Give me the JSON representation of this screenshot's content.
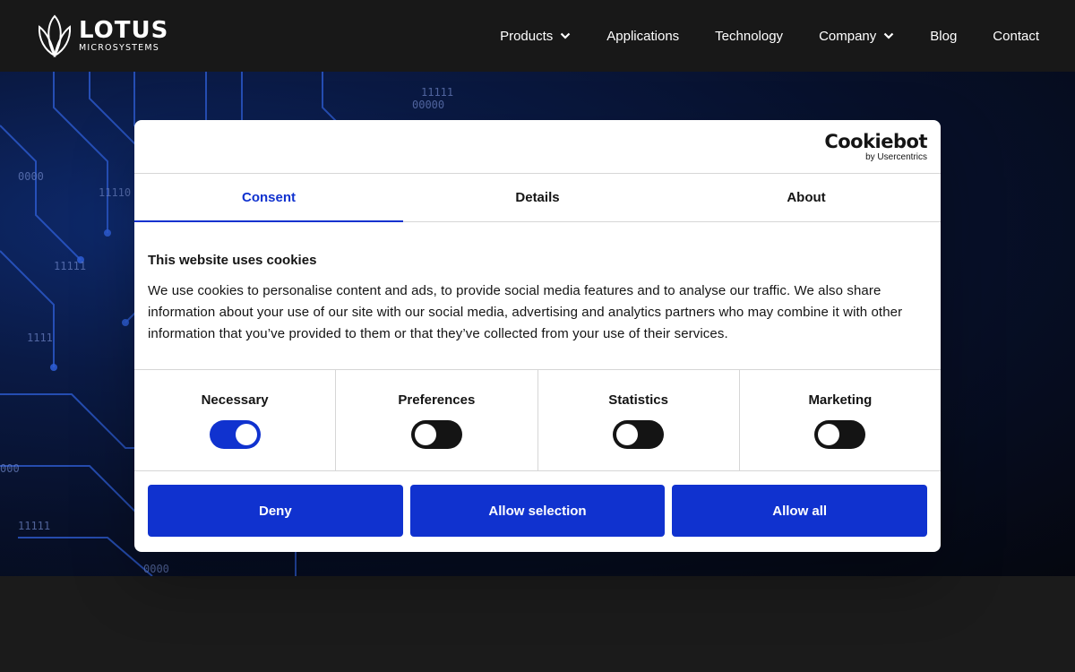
{
  "header": {
    "logo_word": "LOTUS",
    "logo_sub": "MICROSYSTEMS",
    "nav": [
      {
        "label": "Products",
        "has_dropdown": true
      },
      {
        "label": "Applications",
        "has_dropdown": false
      },
      {
        "label": "Technology",
        "has_dropdown": false
      },
      {
        "label": "Company",
        "has_dropdown": true
      },
      {
        "label": "Blog",
        "has_dropdown": false
      },
      {
        "label": "Contact",
        "has_dropdown": false
      }
    ]
  },
  "dialog": {
    "brand": "Cookiebot",
    "brand_sub": "by Usercentrics",
    "tabs": [
      {
        "label": "Consent",
        "active": true
      },
      {
        "label": "Details",
        "active": false
      },
      {
        "label": "About",
        "active": false
      }
    ],
    "heading": "This website uses cookies",
    "text": "We use cookies to personalise content and ads, to provide social media features and to analyse our traffic. We also share information about your use of our site with our social media, advertising and analytics partners who may combine it with other information that you’ve provided to them or that they’ve collected from your use of their services.",
    "toggles": [
      {
        "label": "Necessary",
        "on": true
      },
      {
        "label": "Preferences",
        "on": false
      },
      {
        "label": "Statistics",
        "on": false
      },
      {
        "label": "Marketing",
        "on": false
      }
    ],
    "buttons": {
      "deny": "Deny",
      "allow_selection": "Allow selection",
      "allow_all": "Allow all"
    }
  },
  "colors": {
    "accent": "#1032cf",
    "header_bg": "#181818",
    "hero_blue": "#0e2a6e"
  }
}
